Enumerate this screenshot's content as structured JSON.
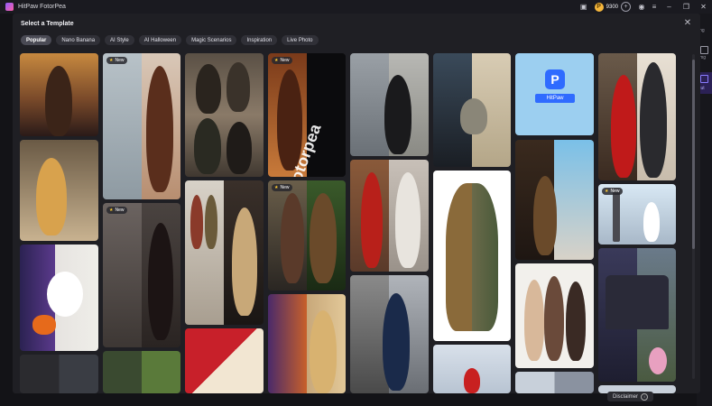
{
  "app": {
    "title": "HitPaw FotorPea",
    "credits": "9300"
  },
  "background": {
    "right_labels": [
      "ing",
      "img",
      "cut"
    ],
    "disclaimer": "Disclaimer"
  },
  "modal": {
    "title": "Select a Template",
    "close_icon": "close-icon",
    "tabs": [
      {
        "label": "Popular",
        "active": true
      },
      {
        "label": "Nano Banana"
      },
      {
        "label": "AI Style"
      },
      {
        "label": "AI Halloween"
      },
      {
        "label": "Magic Scenarios"
      },
      {
        "label": "Inspiration"
      },
      {
        "label": "Live Photo"
      }
    ],
    "badge_new": "New",
    "hitpaw_logo_text": "HitPaw",
    "watermark_text": "Fotorpea"
  },
  "colors": {
    "accent": "#7b5cff",
    "modal_bg": "#1f1f24",
    "coin": "#f6b73c"
  }
}
